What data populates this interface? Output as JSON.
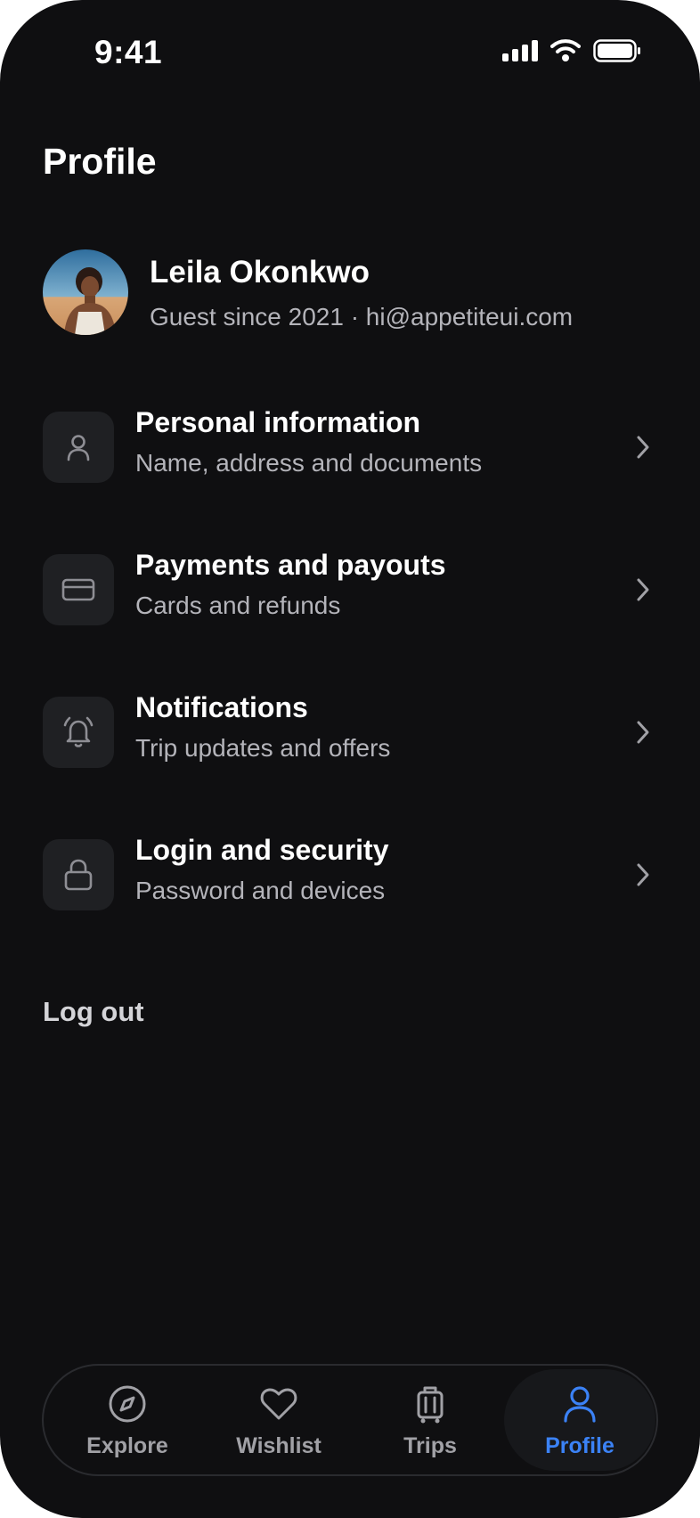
{
  "status_bar": {
    "time": "9:41"
  },
  "header": {
    "title": "Profile"
  },
  "user": {
    "name": "Leila Okonkwo",
    "subtitle": "Guest since 2021 · hi@appetiteui.com"
  },
  "menu": [
    {
      "title": "Personal information",
      "subtitle": "Name, address and documents",
      "icon": "user-icon"
    },
    {
      "title": "Payments and payouts",
      "subtitle": "Cards and refunds",
      "icon": "credit-card-icon"
    },
    {
      "title": "Notifications",
      "subtitle": "Trip updates and offers",
      "icon": "bell-icon"
    },
    {
      "title": "Login and security",
      "subtitle": "Password and devices",
      "icon": "lock-icon"
    }
  ],
  "logout_label": "Log out",
  "tabs": [
    {
      "label": "Explore",
      "icon": "compass-icon",
      "active": false
    },
    {
      "label": "Wishlist",
      "icon": "heart-icon",
      "active": false
    },
    {
      "label": "Trips",
      "icon": "suitcase-icon",
      "active": false
    },
    {
      "label": "Profile",
      "icon": "user-icon",
      "active": true
    }
  ],
  "colors": {
    "background": "#0f0f11",
    "accent": "#3b82f6",
    "card": "#1f2023",
    "muted_text": "#b4b4ba"
  }
}
